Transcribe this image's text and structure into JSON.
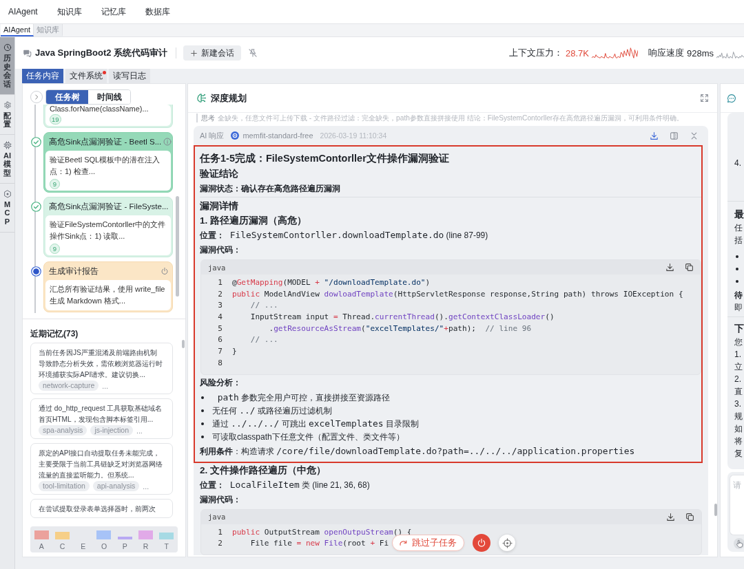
{
  "top_nav": [
    "AIAgent",
    "知识库",
    "记忆库",
    "数据库"
  ],
  "page_tabs": [
    {
      "label": "AIAgent",
      "selected": true
    },
    {
      "label": "知识库",
      "selected": false
    }
  ],
  "side_nav": [
    {
      "kind": "history",
      "label": "历史会话",
      "selected": true
    },
    {
      "kind": "config",
      "label": "配置",
      "selected": false
    },
    {
      "kind": "model",
      "label": "AI模型",
      "selected": false
    },
    {
      "kind": "mcp",
      "label": "MCP",
      "selected": false
    }
  ],
  "session": {
    "title": "Java SpringBoot2 系统代码审计",
    "new_button": "新建会话"
  },
  "metrics": [
    {
      "label": "上下文压力：",
      "value": "28.7K",
      "warning": true
    },
    {
      "label": "响应速度",
      "value": "928ms",
      "warning": false
    }
  ],
  "content_tabs": [
    {
      "label": "任务内容",
      "selected": true,
      "unread": false
    },
    {
      "label": "文件系统",
      "selected": false,
      "unread": true
    },
    {
      "label": "读写日志",
      "selected": false,
      "unread": false
    }
  ],
  "task_panel": {
    "views": [
      {
        "label": "任务树",
        "selected": true
      },
      {
        "label": "时间线",
        "selected": false
      }
    ],
    "tasks": [
      {
        "done": true,
        "selected": false,
        "description": "Class.forName(className)...",
        "count": "19"
      },
      {
        "done": true,
        "selected": true,
        "title": "高危Sink点漏洞验证 - Beetl S...",
        "description": "验证Beetl SQL模板中的潜在注入点：1) 检查...",
        "count": "9"
      },
      {
        "done": true,
        "selected": false,
        "title": "高危Sink点漏洞验证 - FileSyste...",
        "description": "验证FileSystemContorller中的文件操作Sink点：1) 读取...",
        "count": "9"
      },
      {
        "done": false,
        "selected": false,
        "title": "生成审计报告",
        "description": "汇总所有验证结果，使用 write_file 生成 Markdown 格式..."
      }
    ]
  },
  "memory": {
    "title": "近期记忆(73)",
    "items": [
      {
        "text": "当前任务因JS严重混淆及前端路由机制导致静态分析失效，需依赖浏览器运行时环境捕获实际API请求。建议切换...",
        "tags": [
          "network-capture"
        ],
        "more": "..."
      },
      {
        "text": "通过 do_http_request 工具获取基础域名首页HTML，发现包含脚本标签引用...",
        "tags": [
          "spa-analysis",
          "js-injection"
        ],
        "more": "..."
      },
      {
        "text": "原定的API接口自动提取任务未能完成，主要受限于当前工具链缺乏对浏览器网络流量的直接监听能力。但系统...",
        "tags": [
          "tool-limitation",
          "api-analysis"
        ],
        "more": "..."
      },
      {
        "text": "在尝试提取登录表单选择器时，前两次"
      }
    ],
    "categories": [
      {
        "label": "A",
        "color": "#eba19c"
      },
      {
        "label": "C",
        "color": "#f6cf88"
      },
      {
        "label": "E"
      },
      {
        "label": "O",
        "color": "#a7c3f7"
      },
      {
        "label": "P",
        "color": "#b8a9f3"
      },
      {
        "label": "R",
        "color": "#e1aae8"
      },
      {
        "label": "T",
        "color": "#a6dae4"
      }
    ]
  },
  "planner": {
    "title": "深度规划",
    "thought": {
      "label": "思考",
      "text": "全缺失，任意文件可上传下载 - 文件路径过滤：完全缺失，path参数直接拼接使用 结论：FileSystemContorller存在高危路径遍历漏洞，可利用条件明确。"
    },
    "response": {
      "label": "AI 响应",
      "model": "memfit-standard-free",
      "time": "2026-03-19 11:10:34",
      "sections": [
        {
          "highlighted": true,
          "blocks": [
            {
              "kind": "h1",
              "text": "任务1-5完成：FileSystemContorller文件操作漏洞验证"
            },
            {
              "kind": "h2",
              "text": "验证结论"
            },
            {
              "kind": "para",
              "parts": [
                {
                  "kind": "strong",
                  "text": "漏洞状态：确认存在高危路径遍历漏洞"
                }
              ]
            },
            {
              "kind": "rule"
            },
            {
              "kind": "h2",
              "text": "漏洞详情"
            },
            {
              "kind": "h3",
              "text": "1. 路径遍历漏洞（高危）"
            },
            {
              "kind": "para",
              "parts": [
                {
                  "kind": "strong",
                  "text": "位置："
                },
                {
                  "kind": "code",
                  "text": " FileSystemContorller.downloadTemplate.do"
                },
                {
                  "kind": "text",
                  "text": " (line 87-99)"
                }
              ]
            },
            {
              "kind": "para",
              "parts": [
                {
                  "kind": "strong",
                  "text": "漏洞代码："
                }
              ]
            },
            {
              "kind": "code",
              "language": "java",
              "lines": [
                {
                  "number": "1",
                  "tokens": [
                    {
                      "kind": "plain",
                      "text": "@"
                    },
                    {
                      "kind": "keyword",
                      "text": "GetMapping"
                    },
                    {
                      "kind": "plain",
                      "text": "(MODEL"
                    },
                    {
                      "kind": "op",
                      "text": " + "
                    },
                    {
                      "kind": "string",
                      "text": "\"/downloadTemplate.do\""
                    },
                    {
                      "kind": "plain",
                      "text": ")"
                    }
                  ]
                },
                {
                  "number": "2",
                  "tokens": [
                    {
                      "kind": "keyword",
                      "text": "public"
                    },
                    {
                      "kind": "plain",
                      "text": " ModelAndView "
                    },
                    {
                      "kind": "function",
                      "text": "dowloadTemplate"
                    },
                    {
                      "kind": "plain",
                      "text": "(HttpServletResponse response,String path) throws IOException {"
                    }
                  ]
                },
                {
                  "number": "3",
                  "tokens": [
                    {
                      "kind": "comment",
                      "text": "    // ..."
                    }
                  ]
                },
                {
                  "number": "4",
                  "tokens": [
                    {
                      "kind": "plain",
                      "text": "    InputStream input"
                    },
                    {
                      "kind": "op",
                      "text": " = "
                    },
                    {
                      "kind": "plain",
                      "text": "Thread."
                    },
                    {
                      "kind": "function",
                      "text": "currentThread"
                    },
                    {
                      "kind": "plain",
                      "text": "()."
                    },
                    {
                      "kind": "function",
                      "text": "getContextClassLoader"
                    },
                    {
                      "kind": "plain",
                      "text": "()"
                    }
                  ]
                },
                {
                  "number": "5",
                  "tokens": [
                    {
                      "kind": "plain",
                      "text": "        ."
                    },
                    {
                      "kind": "function",
                      "text": "getResourceAsStream"
                    },
                    {
                      "kind": "plain",
                      "text": "("
                    },
                    {
                      "kind": "string",
                      "text": "\"excelTemplates/\""
                    },
                    {
                      "kind": "op",
                      "text": "+"
                    },
                    {
                      "kind": "plain",
                      "text": "path);  "
                    },
                    {
                      "kind": "comment",
                      "text": "// line 96"
                    }
                  ]
                },
                {
                  "number": "6",
                  "tokens": [
                    {
                      "kind": "comment",
                      "text": "    // ..."
                    }
                  ]
                },
                {
                  "number": "7",
                  "tokens": [
                    {
                      "kind": "plain",
                      "text": "}"
                    }
                  ]
                },
                {
                  "number": "8"
                }
              ]
            },
            {
              "kind": "para",
              "parts": [
                {
                  "kind": "strong",
                  "text": "风险分析："
                }
              ]
            },
            {
              "kind": "list",
              "items": [
                {
                  "parts": [
                    {
                      "kind": "code",
                      "text": " path"
                    },
                    {
                      "kind": "text",
                      "text": " 参数完全用户可控，直接拼接至资源路径"
                    }
                  ]
                },
                {
                  "parts": [
                    {
                      "kind": "text",
                      "text": "无任何 "
                    },
                    {
                      "kind": "code",
                      "text": "../"
                    },
                    {
                      "kind": "text",
                      "text": " 或路径遍历过滤机制"
                    }
                  ]
                },
                {
                  "parts": [
                    {
                      "kind": "text",
                      "text": "通过 "
                    },
                    {
                      "kind": "code",
                      "text": "../../../"
                    },
                    {
                      "kind": "text",
                      "text": " 可跳出 "
                    },
                    {
                      "kind": "code",
                      "text": "excelTemplates"
                    },
                    {
                      "kind": "text",
                      "text": " 目录限制"
                    }
                  ]
                },
                {
                  "parts": [
                    {
                      "kind": "text",
                      "text": "可读取classpath下任意文件（配置文件、类文件等）"
                    }
                  ]
                }
              ]
            },
            {
              "kind": "para",
              "parts": [
                {
                  "kind": "strong",
                  "text": "利用条件"
                },
                {
                  "kind": "text",
                  "text": "：构造请求 "
                },
                {
                  "kind": "code",
                  "text": "/core/file/downloadTemplate.do?path=../../../application.properties"
                }
              ]
            }
          ]
        },
        {
          "highlighted": false,
          "blocks": [
            {
              "kind": "h3",
              "text": "2. 文件操作路径遍历（中危）"
            },
            {
              "kind": "para",
              "parts": [
                {
                  "kind": "strong",
                  "text": "位置："
                },
                {
                  "kind": "code",
                  "text": " LocalFileItem"
                },
                {
                  "kind": "text",
                  "text": " 类 (line 21, 36, 68)"
                }
              ]
            },
            {
              "kind": "para",
              "parts": [
                {
                  "kind": "strong",
                  "text": "漏洞代码："
                }
              ]
            },
            {
              "kind": "code",
              "language": "java",
              "lines": [
                {
                  "number": "1",
                  "tokens": [
                    {
                      "kind": "keyword",
                      "text": "public"
                    },
                    {
                      "kind": "plain",
                      "text": " OutputStream "
                    },
                    {
                      "kind": "function",
                      "text": "openOutpuStream"
                    },
                    {
                      "kind": "plain",
                      "text": "() {"
                    }
                  ]
                },
                {
                  "number": "2",
                  "tokens": [
                    {
                      "kind": "plain",
                      "text": "    File file"
                    },
                    {
                      "kind": "op",
                      "text": " = "
                    },
                    {
                      "kind": "keyword",
                      "text": "new"
                    },
                    {
                      "kind": "function",
                      "text": " File"
                    },
                    {
                      "kind": "plain",
                      "text": "(root"
                    },
                    {
                      "kind": "op",
                      "text": " + "
                    },
                    {
                      "kind": "plain",
                      "text": "Fi"
                    }
                  ]
                }
              ]
            }
          ]
        }
      ]
    },
    "skip_button": "跳过子任务"
  },
  "assistant": {
    "lines": [
      {
        "kind": "number",
        "text": "4."
      },
      {
        "kind": "rule"
      },
      {
        "kind": "heading",
        "text": "最"
      },
      {
        "kind": "text",
        "text": "任"
      },
      {
        "kind": "text",
        "text": "括"
      },
      {
        "kind": "bullet"
      },
      {
        "kind": "bullet"
      },
      {
        "kind": "bullet"
      },
      {
        "kind": "strong",
        "text": "待"
      },
      {
        "kind": "text",
        "text": "即"
      },
      {
        "kind": "rule"
      },
      {
        "kind": "heading",
        "text": "下"
      },
      {
        "kind": "text",
        "text": "您"
      },
      {
        "kind": "text",
        "text": "1."
      },
      {
        "kind": "text",
        "text": "立"
      },
      {
        "kind": "text",
        "text": "2."
      },
      {
        "kind": "text",
        "text": "直"
      },
      {
        "kind": "text",
        "text": "3."
      },
      {
        "kind": "text",
        "text": "规"
      },
      {
        "kind": "text",
        "text": "如"
      },
      {
        "kind": "text",
        "text": "将"
      },
      {
        "kind": "text",
        "text": "复"
      }
    ],
    "input": {
      "placeholder": "请"
    }
  }
}
